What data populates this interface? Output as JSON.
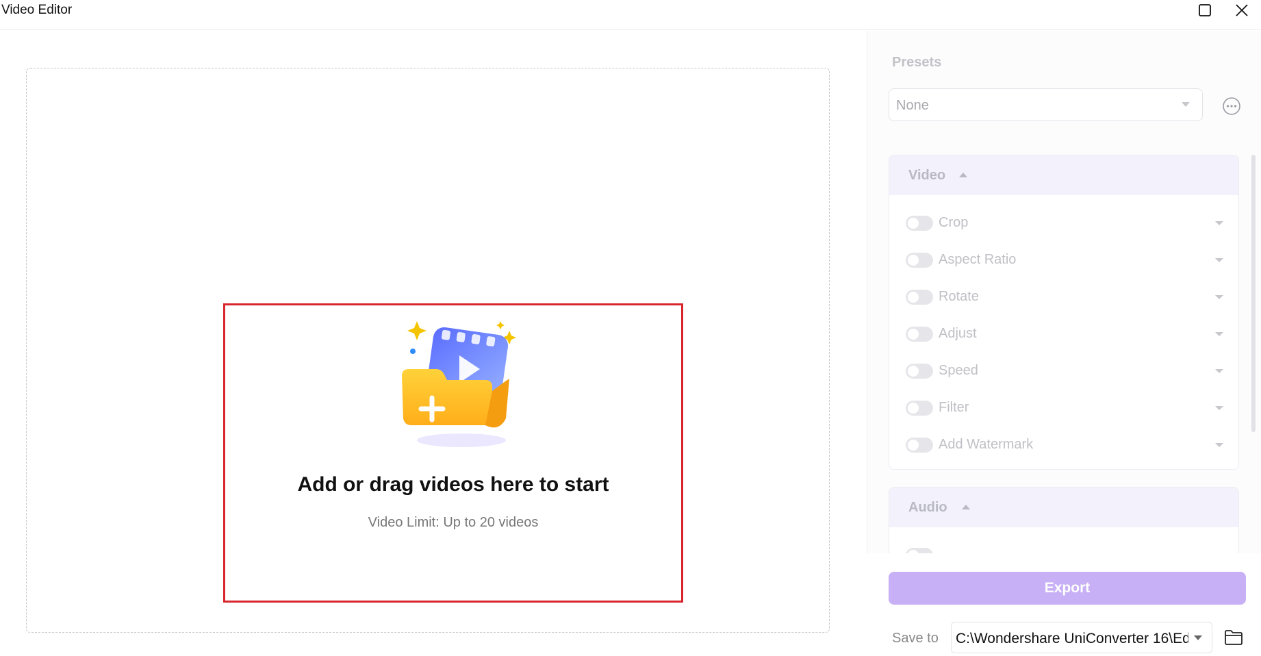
{
  "window": {
    "title": "Video Editor"
  },
  "drop_zone": {
    "headline": "Add or drag videos here to start",
    "limit_text": "Video Limit: Up to 20 videos"
  },
  "presets": {
    "label": "Presets",
    "selected": "None"
  },
  "video_section": {
    "label": "Video",
    "options": [
      {
        "label": "Crop",
        "enabled": false
      },
      {
        "label": "Aspect Ratio",
        "enabled": false
      },
      {
        "label": "Rotate",
        "enabled": false
      },
      {
        "label": "Adjust",
        "enabled": false
      },
      {
        "label": "Speed",
        "enabled": false
      },
      {
        "label": "Filter",
        "enabled": false
      },
      {
        "label": "Add Watermark",
        "enabled": false
      }
    ]
  },
  "audio_section": {
    "label": "Audio"
  },
  "export": {
    "button_label": "Export",
    "save_to_label": "Save to",
    "save_path": "C:\\Wondershare UniConverter 16\\Ed"
  },
  "colors": {
    "accent": "#c7b0f5",
    "highlight_border": "#d9262e"
  }
}
